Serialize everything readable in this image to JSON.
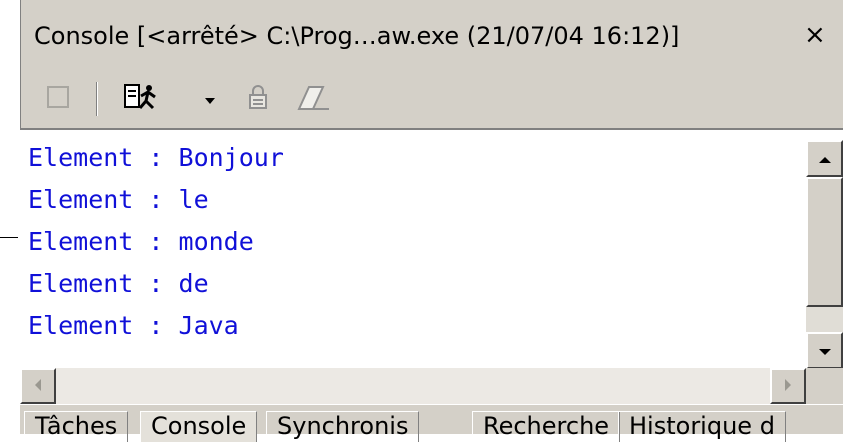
{
  "view": {
    "title": "Console [<arrêté> C:\\Prog…aw.exe (21/07/04 16:12)]",
    "close_label": "×"
  },
  "toolbar": {
    "buttons": [
      {
        "name": "terminate-icon"
      },
      {
        "name": "run-icon"
      },
      {
        "name": "dropdown-arrow-icon"
      },
      {
        "name": "scroll-lock-icon"
      },
      {
        "name": "clear-console-icon"
      }
    ]
  },
  "console": {
    "lines": [
      "Element : Bonjour",
      "Element : le",
      "Element : monde",
      "Element : de",
      "Element : Java"
    ],
    "text_color": "#1010d8"
  },
  "tabs": [
    {
      "label": "Tâches"
    },
    {
      "label": "Console"
    },
    {
      "label": "Synchronis"
    },
    {
      "label": "Recherche"
    },
    {
      "label": "Historique d"
    }
  ]
}
